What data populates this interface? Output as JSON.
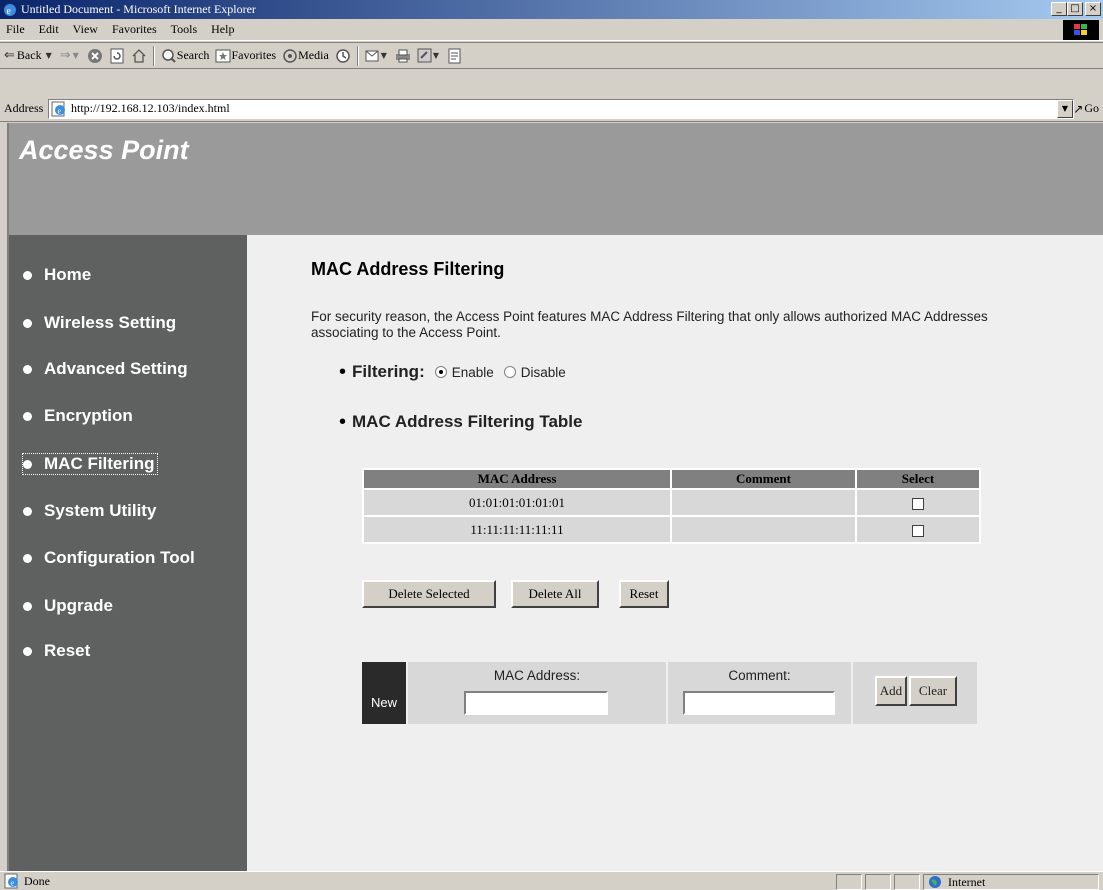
{
  "window": {
    "title": "Untitled Document - Microsoft Internet Explorer",
    "controls": [
      "_",
      "□",
      "×"
    ]
  },
  "menu": [
    "File",
    "Edit",
    "View",
    "Favorites",
    "Tools",
    "Help"
  ],
  "toolbar": {
    "back": "Back",
    "search": "Search",
    "favorites": "Favorites",
    "media": "Media"
  },
  "address": {
    "label": "Address",
    "url": "http://192.168.12.103/index.html",
    "go": "Go"
  },
  "banner": {
    "brand": "Access Point"
  },
  "sidebar": {
    "items": [
      {
        "label": "Home"
      },
      {
        "label": "Wireless Setting"
      },
      {
        "label": "Advanced Setting"
      },
      {
        "label": "Encryption"
      },
      {
        "label": "MAC Filtering"
      },
      {
        "label": "System Utility"
      },
      {
        "label": "Configuration Tool"
      },
      {
        "label": "Upgrade"
      },
      {
        "label": "Reset"
      }
    ],
    "active": "MAC Filtering"
  },
  "main": {
    "title": "MAC Address Filtering",
    "description": "For security reason, the Access Point features MAC Address Filtering that only allows authorized MAC Addresses associating to the Access Point.",
    "filtering": {
      "label": "Filtering:",
      "enable": "Enable",
      "disable": "Disable",
      "selected": "Enable"
    },
    "table_heading": "MAC Address Filtering Table",
    "table": {
      "headers": [
        "MAC Address",
        "Comment",
        "Select"
      ],
      "rows": [
        {
          "mac": "01:01:01:01:01:01",
          "comment": ""
        },
        {
          "mac": "11:11:11:11:11:11",
          "comment": ""
        }
      ]
    },
    "buttons": {
      "delete_selected": "Delete Selected",
      "delete_all": "Delete All",
      "reset": "Reset"
    },
    "new_entry": {
      "new_label": "New",
      "mac_label": "MAC Address:",
      "comment_label": "Comment:",
      "add": "Add",
      "clear": "Clear"
    }
  },
  "status": {
    "text": "Done",
    "zone": "Internet"
  }
}
